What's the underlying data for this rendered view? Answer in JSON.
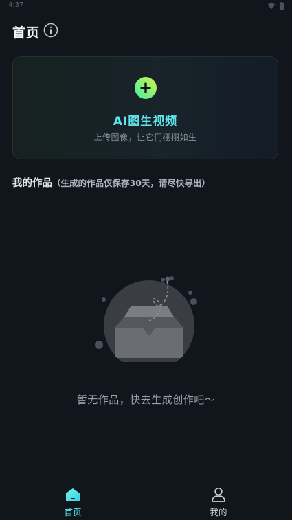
{
  "status_bar": {
    "time": "4:37"
  },
  "header": {
    "title": "首页",
    "info_icon": "info-circle-icon"
  },
  "create_card": {
    "icon": "plus-circle-icon",
    "title": "AI图生视频",
    "subtitle": "上传图像，让它们栩栩如生"
  },
  "works": {
    "heading": "我的作品",
    "note": "（生成的作品仅保存30天，请尽快导出）"
  },
  "empty_state": {
    "illustration": "empty-inbox-icon",
    "text": "暂无作品，快去生成创作吧～"
  },
  "bottom_nav": {
    "items": [
      {
        "label": "首页",
        "icon": "home-icon",
        "active": true
      },
      {
        "label": "我的",
        "icon": "user-icon",
        "active": false
      }
    ]
  },
  "colors": {
    "accent": "#5fe3e8",
    "background": "#11161c",
    "plus_gradient_start": "#3ff0a8",
    "plus_gradient_end": "#d6f04a"
  }
}
